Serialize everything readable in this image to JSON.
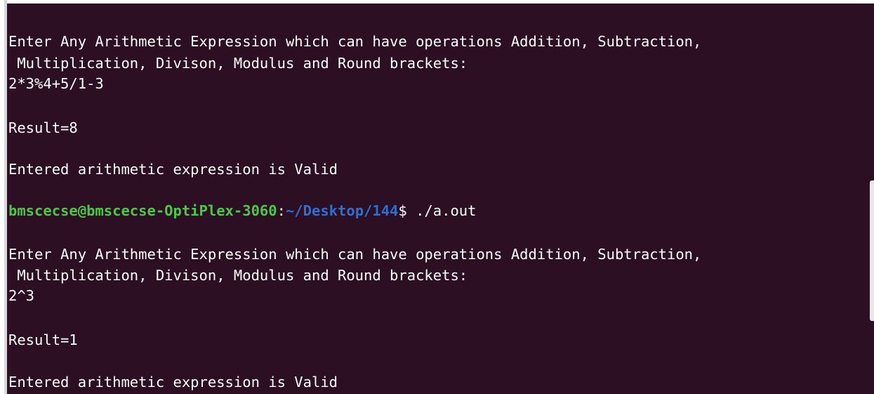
{
  "colors": {
    "background": "#2c0f23",
    "text": "#ffffff",
    "prompt_user": "#4cc74a",
    "prompt_path": "#2e6fd1"
  },
  "terminal": {
    "lines": [
      "Enter Any Arithmetic Expression which can have operations Addition, Subtraction,",
      " Multiplication, Divison, Modulus and Round brackets:",
      "2*3%4+5/1-3",
      "",
      "Result=8",
      "",
      "Entered arithmetic expression is Valid",
      "",
      "",
      "",
      "Enter Any Arithmetic Expression which can have operations Addition, Subtraction,",
      " Multiplication, Divison, Modulus and Round brackets:",
      "2^3",
      "",
      "Result=1",
      "",
      "Entered arithmetic expression is Valid"
    ],
    "prompt": {
      "user_host": "bmscecse@bmscecse-OptiPlex-3060",
      "separator": ":",
      "path": "~/Desktop/144",
      "dollar": "$",
      "command": " ./a.out"
    }
  }
}
